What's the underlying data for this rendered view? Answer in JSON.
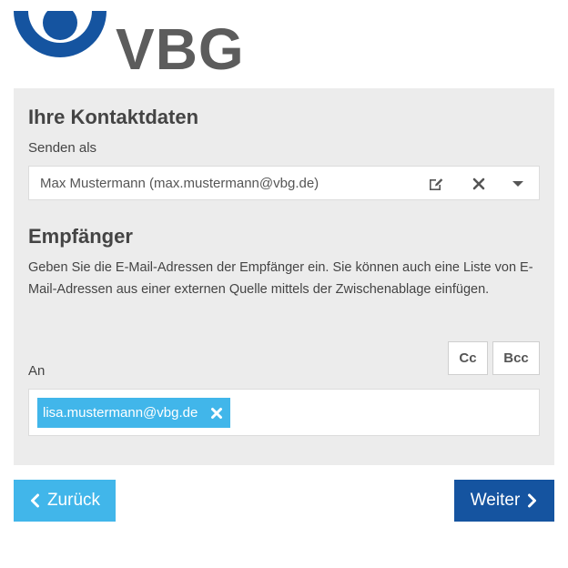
{
  "brand": {
    "logo_text": "VBG",
    "logo_color": "#5c5c5c",
    "mark_color": "#1554a0"
  },
  "contact": {
    "title": "Ihre Kontaktdaten",
    "send_as_label": "Senden als",
    "send_as_value": "Max Mustermann (max.mustermann@vbg.de)",
    "icons": [
      "edit-icon",
      "clear-icon",
      "chevron-down-icon"
    ]
  },
  "recipients": {
    "title": "Empfänger",
    "description": "Geben Sie die E-Mail-Adressen der Empfänger ein. Sie können auch eine Liste von E-Mail-Adressen aus einer externen Quelle mittels der Zwischenablage einfügen.",
    "to_label": "An",
    "cc_label": "Cc",
    "bcc_label": "Bcc",
    "tags": [
      "lisa.mustermann@vbg.de"
    ],
    "tag_color": "#41b6ea"
  },
  "nav": {
    "back_label": "Zurück",
    "next_label": "Weiter",
    "back_color": "#41b6ea",
    "next_color": "#1554a0"
  }
}
